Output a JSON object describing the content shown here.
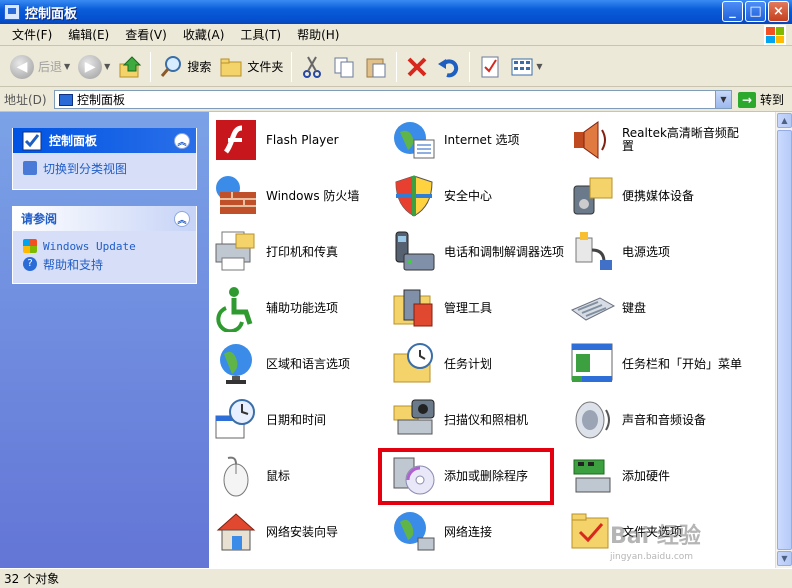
{
  "window": {
    "title": "控制面板",
    "controls": {
      "minimize": "_",
      "maximize": "□",
      "close": "×"
    }
  },
  "menu": [
    "文件(F)",
    "编辑(E)",
    "查看(V)",
    "收藏(A)",
    "工具(T)",
    "帮助(H)"
  ],
  "toolbar": {
    "back": "后退",
    "forward": "",
    "search": "搜索",
    "folders": "文件夹"
  },
  "address": {
    "label": "地址(D)",
    "value": "控制面板",
    "go": "转到"
  },
  "left_panels": {
    "control_panel": {
      "title": "控制面板",
      "link": "切换到分类视图"
    },
    "see_also": {
      "title": "请参阅",
      "links": [
        "Windows Update",
        "帮助和支持"
      ]
    }
  },
  "items": [
    {
      "label": "Flash Player",
      "icon": "flash-player-icon"
    },
    {
      "label": "Internet 选项",
      "icon": "internet-options-icon"
    },
    {
      "label": "Realtek高清晰音频配置",
      "icon": "speaker-config-icon"
    },
    {
      "label": "Windows 防火墙",
      "icon": "firewall-icon"
    },
    {
      "label": "安全中心",
      "icon": "security-shield-icon"
    },
    {
      "label": "便携媒体设备",
      "icon": "portable-media-icon"
    },
    {
      "label": "打印机和传真",
      "icon": "printer-icon"
    },
    {
      "label": "电话和调制解调器选项",
      "icon": "phone-modem-icon"
    },
    {
      "label": "电源选项",
      "icon": "power-plug-icon"
    },
    {
      "label": "辅助功能选项",
      "icon": "accessibility-icon"
    },
    {
      "label": "管理工具",
      "icon": "admin-tools-icon"
    },
    {
      "label": "键盘",
      "icon": "keyboard-icon"
    },
    {
      "label": "区域和语言选项",
      "icon": "globe-icon"
    },
    {
      "label": "任务计划",
      "icon": "scheduled-tasks-icon"
    },
    {
      "label": "任务栏和「开始」菜单",
      "icon": "taskbar-icon"
    },
    {
      "label": "日期和时间",
      "icon": "calendar-clock-icon"
    },
    {
      "label": "扫描仪和照相机",
      "icon": "scanner-camera-icon"
    },
    {
      "label": "声音和音频设备",
      "icon": "sound-speaker-icon"
    },
    {
      "label": "鼠标",
      "icon": "mouse-icon"
    },
    {
      "label": "添加或删除程序",
      "icon": "add-remove-programs-icon"
    },
    {
      "label": "添加硬件",
      "icon": "add-hardware-icon"
    },
    {
      "label": "网络安装向导",
      "icon": "network-home-icon"
    },
    {
      "label": "网络连接",
      "icon": "network-connections-icon"
    },
    {
      "label": "文件夹选项",
      "icon": "folder-options-icon"
    }
  ],
  "status": "32 个对象",
  "watermark": {
    "line1": "Bai 经验",
    "line2": "jingyan.baidu.com"
  }
}
